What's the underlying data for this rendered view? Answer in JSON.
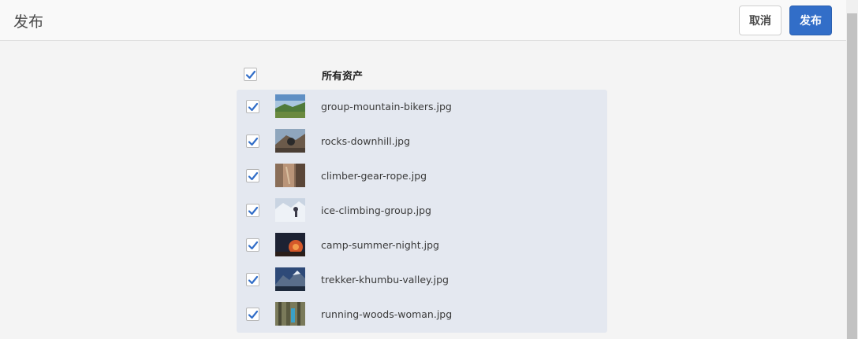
{
  "header": {
    "title": "发布",
    "cancel_label": "取消",
    "publish_label": "发布"
  },
  "selection": {
    "all_label": "所有资产",
    "all_checked": true
  },
  "assets": [
    {
      "name": "group-mountain-bikers.jpg",
      "checked": true
    },
    {
      "name": "rocks-downhill.jpg",
      "checked": true
    },
    {
      "name": "climber-gear-rope.jpg",
      "checked": true
    },
    {
      "name": "ice-climbing-group.jpg",
      "checked": true
    },
    {
      "name": "camp-summer-night.jpg",
      "checked": true
    },
    {
      "name": "trekker-khumbu-valley.jpg",
      "checked": true
    },
    {
      "name": "running-woods-woman.jpg",
      "checked": true
    }
  ],
  "colors": {
    "accent": "#326ec8",
    "checkmark": "#326ec8",
    "list_background": "#e4e8f0"
  },
  "icons": {
    "checkmark": "checkmark-icon"
  }
}
